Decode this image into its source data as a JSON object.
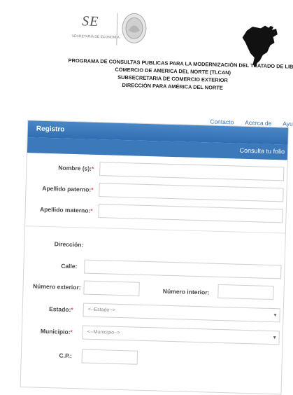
{
  "header": {
    "logo_se": "SE",
    "logo_subtitle": "SECRETARÍA DE ECONOMÍA",
    "title_lines": [
      "PROGRAMA DE CONSULTAS PUBLICAS PARA LA MODERNIZACIÓN DEL TRATADO DE LIBRE",
      "COMERCIO DE AMERICA DEL NORTE (TLCAN)",
      "SUBSECRETARIA DE COMERCIO EXTERIOR",
      "DIRECCIÓN PARA AMÉRICA DEL NORTE"
    ]
  },
  "nav": {
    "items": [
      "Contacto",
      "Acerca de",
      "Ayuda"
    ]
  },
  "panel": {
    "title": "Registro",
    "consulta_link": "Consulta tu folio"
  },
  "form": {
    "nombre_label": "Nombre (s):",
    "apellido_paterno_label": "Apellido paterno:",
    "apellido_materno_label": "Apellido materno:",
    "direccion_label": "Dirección:",
    "calle_label": "Calle:",
    "numero_exterior_label": "Número exterior:",
    "numero_interior_label": "Número interior:",
    "estado_label": "Estado:",
    "estado_value": "<--Estado-->",
    "municipio_label": "Municipio:",
    "municipio_value": "<--Municipio-->",
    "cp_label": "C.P.:",
    "required_mark": "*"
  },
  "colors": {
    "accent": "#3b79ba",
    "required": "#d9534f",
    "link": "#3a73b0"
  }
}
